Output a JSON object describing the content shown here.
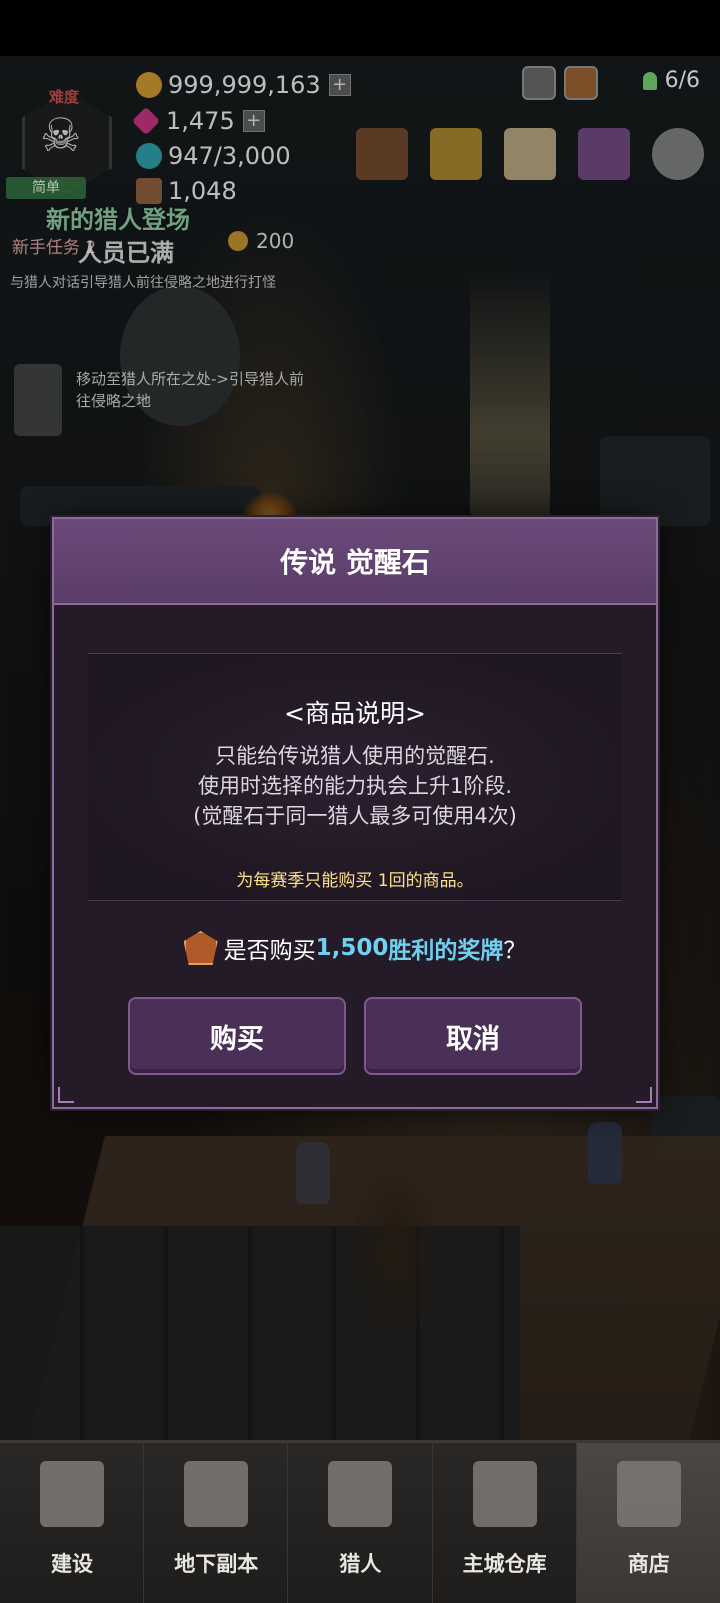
{
  "hud": {
    "difficulty_title": "难度",
    "difficulty_value": "简单",
    "gold": "999,999,163",
    "gems": "1,475",
    "essence": "947/3,000",
    "chest": "1,048",
    "hunter_count": "6/6"
  },
  "quest": {
    "title": "新的猎人登场",
    "full_text": "人员已满",
    "label": "新手任务 2",
    "reward": "200",
    "description": "与猎人对话引导猎人前往侵略之地进行打怪",
    "npc_hint": "移动至猎人所在之处->引导猎人前往侵略之地"
  },
  "dialog": {
    "title": "传说 觉醒石",
    "section_title": "<商品说明>",
    "lines": [
      "只能给传说猎人使用的觉醒石.",
      "使用时选择的能力执会上升1阶段.",
      "(觉醒石于同一猎人最多可使用4次)"
    ],
    "note": "为每赛季只能购买 1回的商品。",
    "question_prefix": "是否购买",
    "question_price": "1,500",
    "question_item": "胜利的奖牌",
    "question_suffix": "？",
    "buy_label": "购买",
    "cancel_label": "取消"
  },
  "nav": [
    {
      "label": "建设",
      "icon": "hammer-icon"
    },
    {
      "label": "地下副本",
      "icon": "dungeon-gate-icon"
    },
    {
      "label": "猎人",
      "icon": "hunter-icon"
    },
    {
      "label": "主城仓库",
      "icon": "storage-chest-icon"
    },
    {
      "label": "商店",
      "icon": "shop-icon"
    }
  ],
  "colors": {
    "dialog_header": "#6b4a7a",
    "dialog_bg": "#251a28",
    "button": "#4a2f56",
    "accent_price": "#6fd0f0",
    "note": "#ffe08a"
  }
}
